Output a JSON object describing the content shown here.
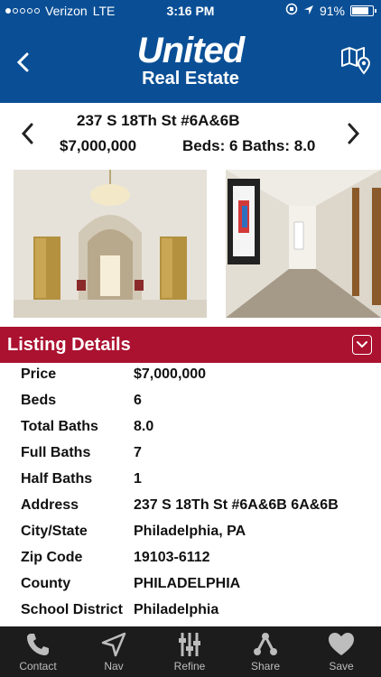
{
  "status": {
    "carrier": "Verizon",
    "network": "LTE",
    "time": "3:16 PM",
    "battery_percent": "91%",
    "battery_level": 0.91
  },
  "header": {
    "brand_name": "United",
    "brand_sub": "Real Estate"
  },
  "listing": {
    "address": "237 S 18Th St #6A&6B",
    "price": "$7,000,000",
    "beds_baths": "Beds: 6  Baths: 8.0"
  },
  "section": {
    "title": "Listing Details"
  },
  "details": [
    {
      "label": "Price",
      "value": "$7,000,000"
    },
    {
      "label": "Beds",
      "value": "6"
    },
    {
      "label": "Total Baths",
      "value": "8.0"
    },
    {
      "label": "Full Baths",
      "value": "7"
    },
    {
      "label": "Half Baths",
      "value": "1"
    },
    {
      "label": "Address",
      "value": "237 S 18Th St #6A&6B 6A&6B"
    },
    {
      "label": "City/State",
      "value": "Philadelphia, PA"
    },
    {
      "label": "Zip Code",
      "value": "19103-6112"
    },
    {
      "label": "County",
      "value": "PHILADELPHIA"
    },
    {
      "label": "School District",
      "value": "Philadelphia"
    }
  ],
  "tabs": [
    {
      "label": "Contact",
      "icon": "phone-icon"
    },
    {
      "label": "Nav",
      "icon": "navigation-arrow-icon"
    },
    {
      "label": "Refine",
      "icon": "sliders-icon"
    },
    {
      "label": "Share",
      "icon": "share-icon"
    },
    {
      "label": "Save",
      "icon": "heart-icon"
    }
  ],
  "colors": {
    "header_blue": "#0a4f96",
    "section_red": "#ab1230",
    "tabbar_bg": "#1c1c1c"
  }
}
